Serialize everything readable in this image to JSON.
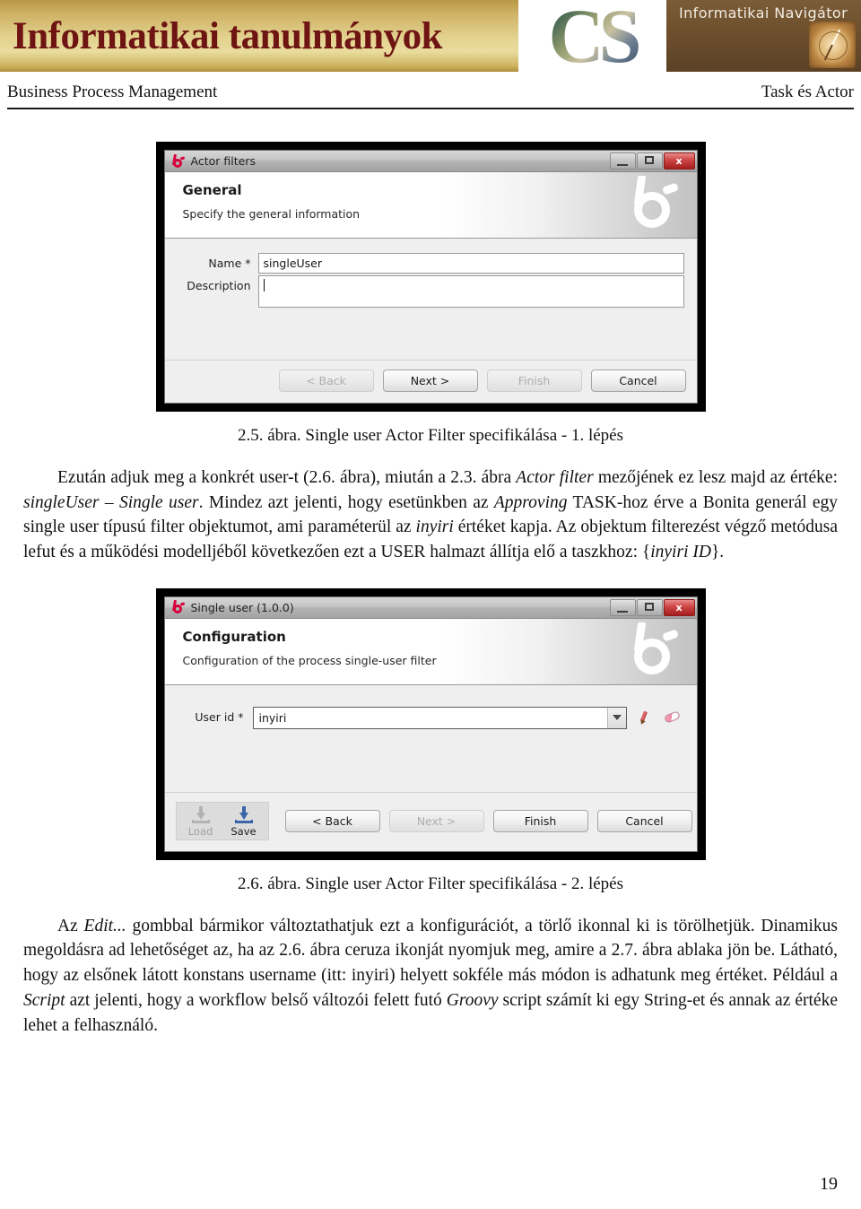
{
  "masthead": {
    "journal_title": "Informatikai tanulmányok",
    "logo_letters": "CS",
    "nav_label": "Informatikai Navigátor",
    "compass_icon": "compass-icon"
  },
  "running_head": {
    "left": "Business Process Management",
    "right": "Task és Actor"
  },
  "figure_1": {
    "window": {
      "app_icon": "bonita-logo-icon",
      "title": "Actor filters",
      "minimize_icon": "minimize-icon",
      "maximize_icon": "maximize-icon",
      "close_icon": "close-icon",
      "close_label": "x",
      "header_title": "General",
      "header_subtitle": "Specify the general information",
      "watermark_icon": "bonita-watermark-icon",
      "fields": [
        {
          "label": "Name *",
          "value": "singleUser",
          "placeholder": ""
        },
        {
          "label": "Description",
          "value": "",
          "placeholder": ""
        }
      ],
      "buttons": [
        {
          "label": "< Back",
          "enabled": false
        },
        {
          "label": "Next >",
          "enabled": true
        },
        {
          "label": "Finish",
          "enabled": false
        },
        {
          "label": "Cancel",
          "enabled": true
        }
      ]
    },
    "caption": "2.5. ábra. Single user Actor Filter specifikálása - 1. lépés"
  },
  "paragraph_1": {
    "runs": [
      {
        "text": "Ezután adjuk meg a konkrét user-t (2.6. ábra), miután a 2.3. ábra ",
        "style": "normal"
      },
      {
        "text": "Actor filter",
        "style": "italic"
      },
      {
        "text": " mezőjének ez lesz majd az értéke: ",
        "style": "normal"
      },
      {
        "text": "singleUser – Single user",
        "style": "italic"
      },
      {
        "text": ". Mindez azt jelenti, hogy esetünkben az ",
        "style": "normal"
      },
      {
        "text": "Approving",
        "style": "italic"
      },
      {
        "text": " TASK-hoz érve a Bonita generál egy single user típusú filter objektumot, ami paraméterül az ",
        "style": "normal"
      },
      {
        "text": "inyiri",
        "style": "italic"
      },
      {
        "text": " értéket kapja. Az objektum filterezést végző metódusa lefut és a működési modelljéből következően ezt a USER halmazt állítja elő a taszkhoz: {",
        "style": "normal"
      },
      {
        "text": "inyiri ID",
        "style": "italic"
      },
      {
        "text": "}.",
        "style": "normal"
      }
    ]
  },
  "figure_2": {
    "window": {
      "app_icon": "bonita-logo-icon",
      "title": "Single user (1.0.0)",
      "minimize_icon": "minimize-icon",
      "maximize_icon": "maximize-icon",
      "close_icon": "close-icon",
      "close_label": "x",
      "header_title": "Configuration",
      "header_subtitle": "Configuration of the process single-user filter",
      "watermark_icon": "bonita-watermark-icon",
      "field": {
        "label": "User id *",
        "value": "inyiri",
        "dropdown_icon": "chevron-down-icon",
        "edit_icon": "pencil-icon",
        "clear_icon": "eraser-icon"
      },
      "toolbar": [
        {
          "label": "Load",
          "icon": "load-icon",
          "enabled": false
        },
        {
          "label": "Save",
          "icon": "save-icon",
          "enabled": true
        }
      ],
      "buttons": [
        {
          "label": "< Back",
          "enabled": true
        },
        {
          "label": "Next >",
          "enabled": false
        },
        {
          "label": "Finish",
          "enabled": true
        },
        {
          "label": "Cancel",
          "enabled": true
        }
      ]
    },
    "caption": "2.6. ábra. Single user Actor Filter specifikálása - 2. lépés"
  },
  "paragraph_2": {
    "runs": [
      {
        "text": "Az ",
        "style": "normal"
      },
      {
        "text": "Edit...",
        "style": "italic"
      },
      {
        "text": " gombbal bármikor változtathatjuk ezt a konfigurációt, a törlő ikonnal ki is törölhetjük. Dinamikus megoldásra ad lehetőséget az, ha az 2.6. ábra ceruza ikonját nyomjuk meg, amire a 2.7. ábra ablaka jön be. Látható, hogy az elsőnek látott konstans username (itt: inyiri) helyett sokféle más módon is adhatunk meg értéket. Például a ",
        "style": "normal"
      },
      {
        "text": "Script",
        "style": "italic"
      },
      {
        "text": " azt jelenti, hogy a workflow belső változói felett futó ",
        "style": "normal"
      },
      {
        "text": "Groovy",
        "style": "italic"
      },
      {
        "text": " script számít ki egy String-et és annak az értéke lehet a felhasználó.",
        "style": "normal"
      }
    ]
  },
  "page_number": "19",
  "colors": {
    "masthead_gold": "#e3d28f",
    "title_maroon": "#6e1412",
    "nav_brown": "#6d4f2d",
    "bonita_red": "#d6003c"
  }
}
